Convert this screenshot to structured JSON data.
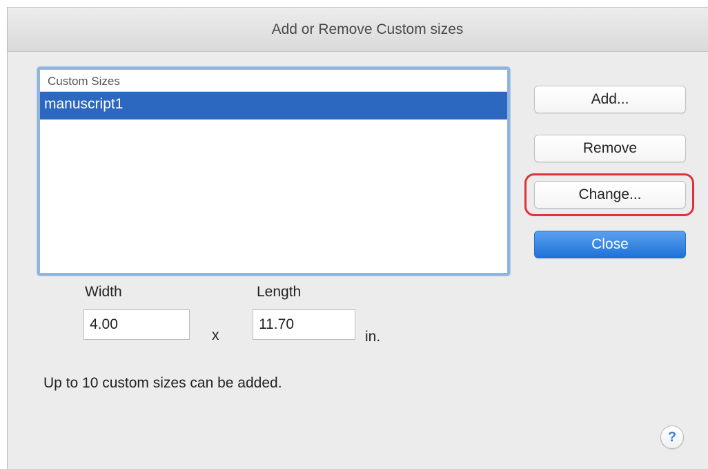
{
  "window": {
    "title": "Add or Remove Custom sizes"
  },
  "list": {
    "header": "Custom Sizes",
    "items": [
      {
        "label": "manuscript1",
        "selected": true
      }
    ]
  },
  "buttons": {
    "add": "Add...",
    "remove": "Remove",
    "change": "Change...",
    "close": "Close"
  },
  "dimensions": {
    "width_label": "Width",
    "width_value": "4.00",
    "separator": "x",
    "length_label": "Length",
    "length_value": "11.70",
    "unit": "in."
  },
  "note": "Up to 10 custom sizes can be added.",
  "help": {
    "icon": "help-icon",
    "glyph": "?"
  },
  "colors": {
    "selection": "#2d68c0",
    "default_button": "#1e72d8",
    "highlight_outline": "#e0323a"
  }
}
